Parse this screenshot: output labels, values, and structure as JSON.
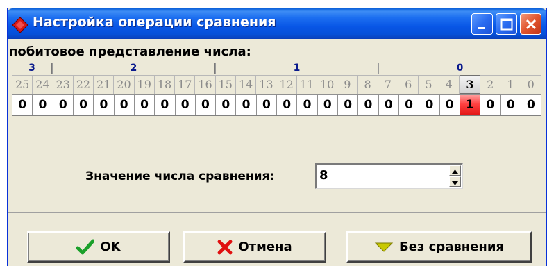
{
  "window": {
    "title": "Настройка операции сравнения"
  },
  "bits": {
    "caption": "побитовое представление числа:",
    "bytes": [
      {
        "label": "3"
      },
      {
        "label": "2"
      },
      {
        "label": "1"
      },
      {
        "label": "0"
      }
    ],
    "indices": [
      "25",
      "24",
      "23",
      "22",
      "21",
      "20",
      "19",
      "18",
      "17",
      "16",
      "15",
      "14",
      "13",
      "12",
      "11",
      "10",
      "9",
      "8",
      "7",
      "6",
      "5",
      "4",
      "3",
      "2",
      "1",
      "0"
    ],
    "values": [
      "0",
      "0",
      "0",
      "0",
      "0",
      "0",
      "0",
      "0",
      "0",
      "0",
      "0",
      "0",
      "0",
      "0",
      "0",
      "0",
      "0",
      "0",
      "0",
      "0",
      "0",
      "0",
      "1",
      "0",
      "0",
      "0"
    ],
    "selected_bit": "3"
  },
  "compare": {
    "label": "Значение числа сравнения:",
    "value": "8"
  },
  "buttons": {
    "ok_label": "OK",
    "cancel_label": "Отмена",
    "no_compare_label": "Без сравнения"
  },
  "icons": {
    "app": "red-diamond-icon",
    "ok": "green-checkmark-icon",
    "cancel": "red-x-icon",
    "no_compare": "yellow-down-triangle-icon"
  }
}
